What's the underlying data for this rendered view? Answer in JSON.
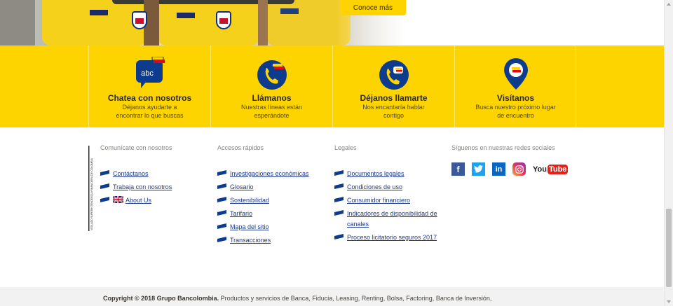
{
  "hero": {
    "cta_label": "Conoce más"
  },
  "contact": {
    "items": [
      {
        "title": "Chatea con nosotros",
        "subtitle": "Déjanos ayudarte a encontrar lo que buscas",
        "icon": "chat-abc-icon"
      },
      {
        "title": "Llámanos",
        "subtitle": "Nuestras líneas están esperándote",
        "icon": "phone-icon"
      },
      {
        "title": "Déjanos llamarte",
        "subtitle": "Nos encantaría hablar contigo",
        "icon": "phone-callback-icon"
      },
      {
        "title": "Visítanos",
        "subtitle": "Busca nuestro próximo lugar de encuentro",
        "icon": "map-pin-icon"
      }
    ]
  },
  "footer": {
    "columns": [
      {
        "title": "Comunícate con nosotros",
        "links": [
          "Contáctanos",
          "Trabaja con nosotros",
          "About Us"
        ]
      },
      {
        "title": "Accesos rápidos",
        "links": [
          "Investigaciones económicas",
          "Glosario",
          "Sostenibilidad",
          "Tarifario",
          "Mapa del sitio",
          "Transacciones"
        ]
      },
      {
        "title": "Legales",
        "links": [
          "Documentos legales",
          "Condiciones de uso",
          "Consumidor financiero",
          "Indicadores de disponibilidad de canales",
          "Proceso licitatorio seguros 2017"
        ]
      },
      {
        "title": "Síguenos en nuestras redes sociales",
        "social": [
          "facebook-icon",
          "twitter-icon",
          "linkedin-icon",
          "instagram-icon",
          "youtube-icon"
        ]
      }
    ],
    "vigilado": "VIGILADO SUPERINTENDENCIA FINANCIERA DE COLOMBIA",
    "youtube_word_1": "You",
    "youtube_word_2": "Tube"
  },
  "copyright": {
    "strong": "Copyright © 2018 Grupo Bancolombia.",
    "text": " Productos y servicios de Banca, Fiducia, Leasing, Renting, Bolsa, Factoring, Banca de Inversión,"
  },
  "colors": {
    "brand_yellow": "#fdd300",
    "brand_blue": "#1f3a8c",
    "icon_blue": "#0d3b8e"
  }
}
